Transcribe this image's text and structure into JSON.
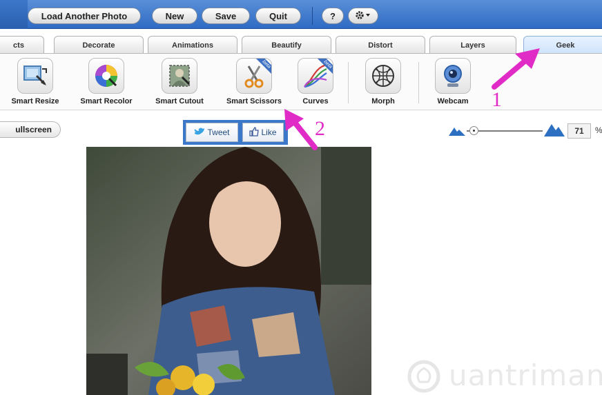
{
  "toolbar": {
    "load_label": "Load Another Photo",
    "new_label": "New",
    "save_label": "Save",
    "quit_label": "Quit",
    "help_label": "?",
    "settings_icon": "gear-icon"
  },
  "tabs": [
    {
      "label": "cts"
    },
    {
      "label": "Decorate"
    },
    {
      "label": "Animations"
    },
    {
      "label": "Beautify"
    },
    {
      "label": "Distort"
    },
    {
      "label": "Layers"
    },
    {
      "label": "Geek",
      "active": true
    }
  ],
  "tools": [
    {
      "label": "Smart Resize",
      "icon": "smart-resize-icon"
    },
    {
      "label": "Smart Recolor",
      "icon": "color-wheel-icon"
    },
    {
      "label": "Smart Cutout",
      "icon": "cutout-icon"
    },
    {
      "label": "Smart Scissors",
      "icon": "scissors-icon",
      "badge": "beta"
    },
    {
      "label": "Curves",
      "icon": "curves-icon",
      "badge": "beta"
    },
    {
      "label": "Morph",
      "icon": "morph-icon"
    },
    {
      "label": "Webcam",
      "icon": "webcam-icon"
    }
  ],
  "view": {
    "fullscreen_label": "ullscreen",
    "tweet_label": "Tweet",
    "like_label": "Like",
    "zoom_value": "71",
    "zoom_unit": "%"
  },
  "annotations": {
    "marker_1": "1",
    "marker_2": "2",
    "color": "#e02bc7"
  },
  "watermark": {
    "text": "uantrimang"
  }
}
